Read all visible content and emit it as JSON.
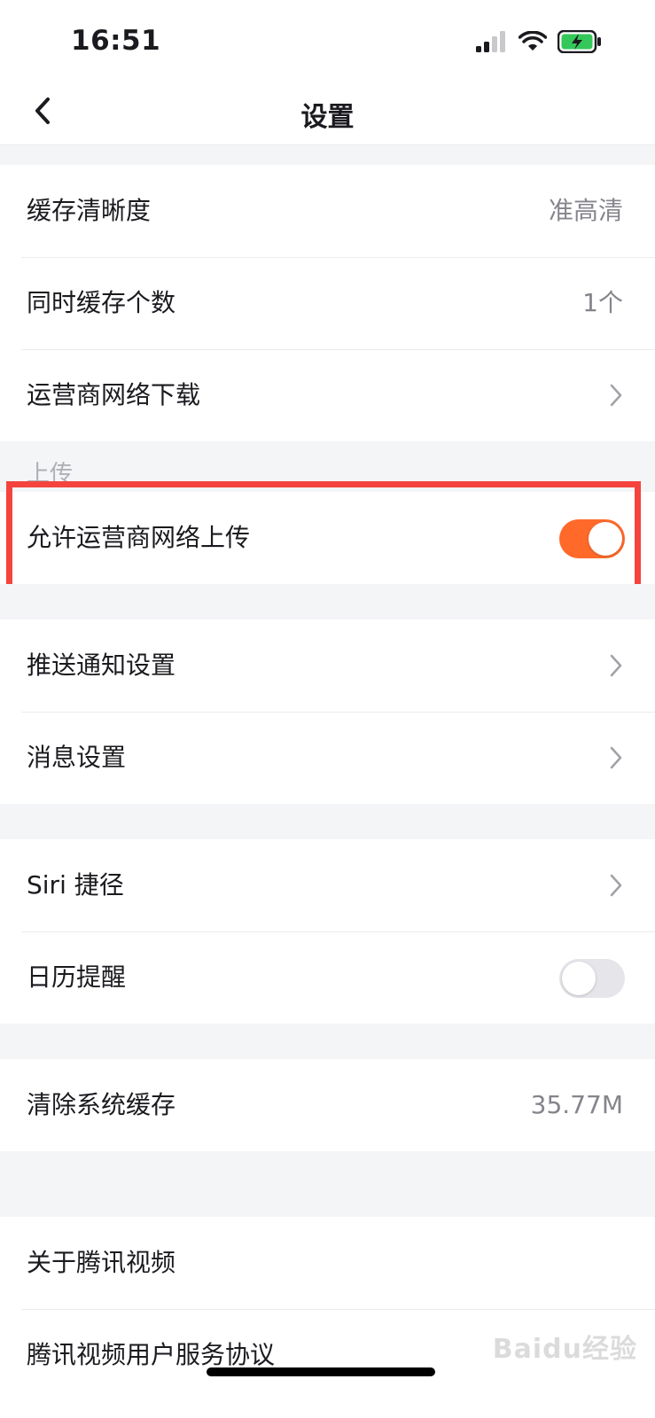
{
  "status_bar": {
    "time": "16:51",
    "icons": [
      "cellular-signal-icon",
      "wifi-icon",
      "battery-charging-icon"
    ]
  },
  "nav": {
    "title": "设置",
    "back_icon": "chevron-left-icon"
  },
  "download_section": {
    "items": [
      {
        "label": "缓存清晰度",
        "value": "准高清"
      },
      {
        "label": "同时缓存个数",
        "value": "1个"
      },
      {
        "label": "运营商网络下载"
      }
    ]
  },
  "upload_section": {
    "header": "上传",
    "items": [
      {
        "label": "允许运营商网络上传",
        "toggle": "on"
      }
    ]
  },
  "notify_section": {
    "items": [
      {
        "label": "推送通知设置"
      },
      {
        "label": "消息设置"
      }
    ]
  },
  "siri_section": {
    "items": [
      {
        "label": "Siri 捷径"
      },
      {
        "label": "日历提醒",
        "toggle": "off"
      }
    ]
  },
  "cache_section": {
    "items": [
      {
        "label": "清除系统缓存",
        "value": "35.77M"
      }
    ]
  },
  "about_section": {
    "items": [
      {
        "label": "关于腾讯视频"
      },
      {
        "label": "腾讯视频用户服务协议"
      }
    ]
  },
  "watermark": "Baidu经验",
  "colors": {
    "accent": "#ff6a2b",
    "highlight": "#f4443d",
    "background": "#f4f5f7",
    "secondary_text": "#85858c"
  }
}
